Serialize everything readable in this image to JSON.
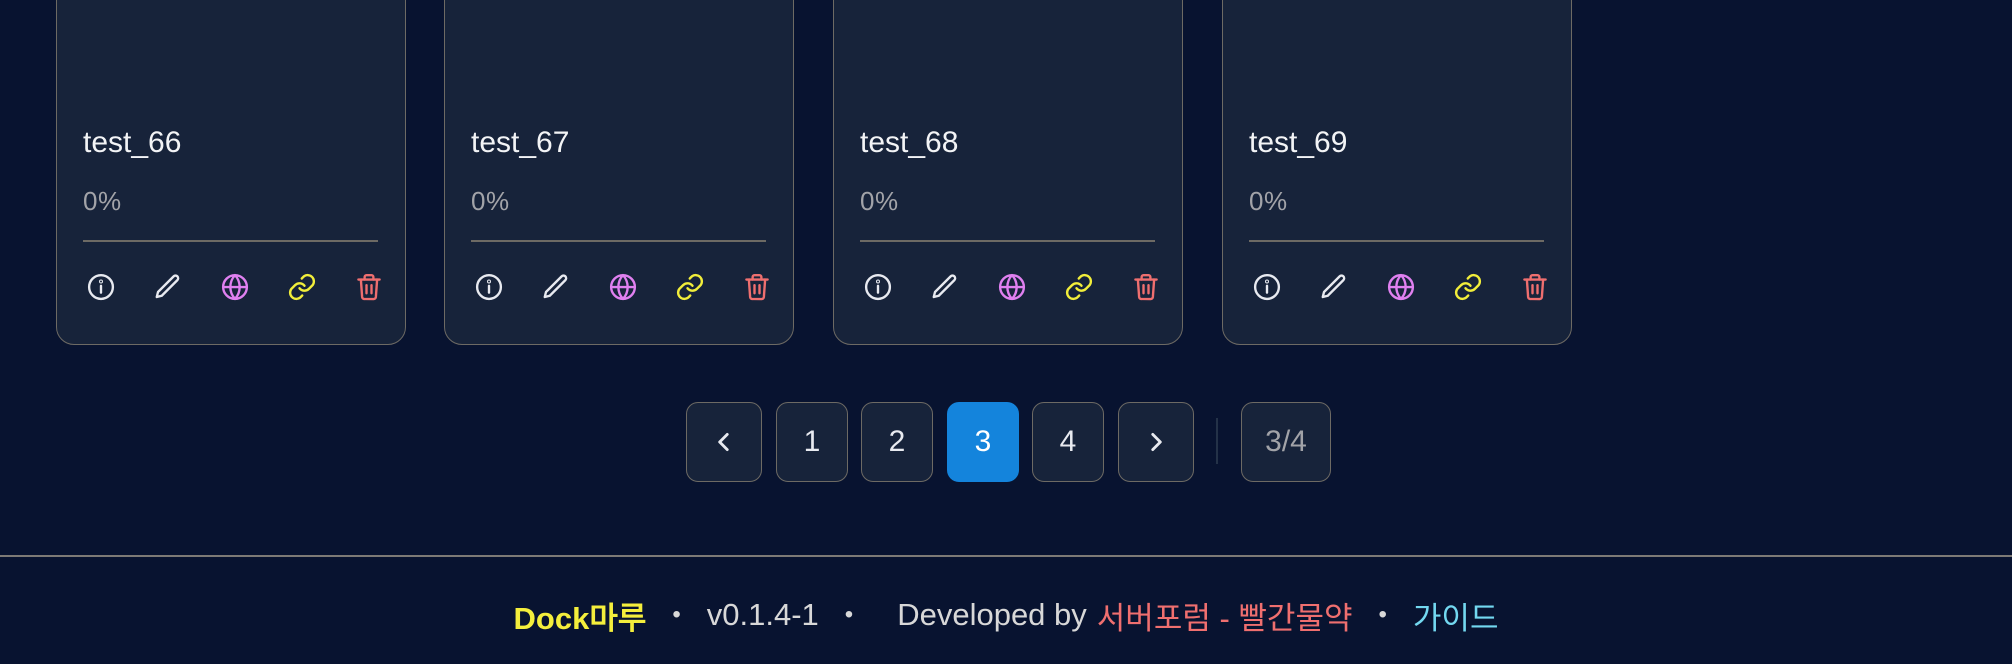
{
  "cards": [
    {
      "title": "test_66",
      "progress": "0%"
    },
    {
      "title": "test_67",
      "progress": "0%"
    },
    {
      "title": "test_68",
      "progress": "0%"
    },
    {
      "title": "test_69",
      "progress": "0%"
    }
  ],
  "card_actions": [
    {
      "icon": "info-icon",
      "color": "#e8eaf0"
    },
    {
      "icon": "pencil-icon",
      "color": "#e8eaf0"
    },
    {
      "icon": "globe-icon",
      "color": "#e080f0"
    },
    {
      "icon": "link-icon",
      "color": "#f2ee3a"
    },
    {
      "icon": "trash-icon",
      "color": "#ef6f6f"
    }
  ],
  "pagination": {
    "prev_icon": "chevron-left-icon",
    "next_icon": "chevron-right-icon",
    "pages": [
      "1",
      "2",
      "3",
      "4"
    ],
    "current_page": "3",
    "indicator": "3/4",
    "active_color": "#1484dc"
  },
  "footer": {
    "brand": "Dock마루",
    "separator": "•",
    "version": "v0.1.4-1",
    "developed_by": "Developed by",
    "developer": "서버포럼 - 빨간물약",
    "guide": "가이드"
  }
}
